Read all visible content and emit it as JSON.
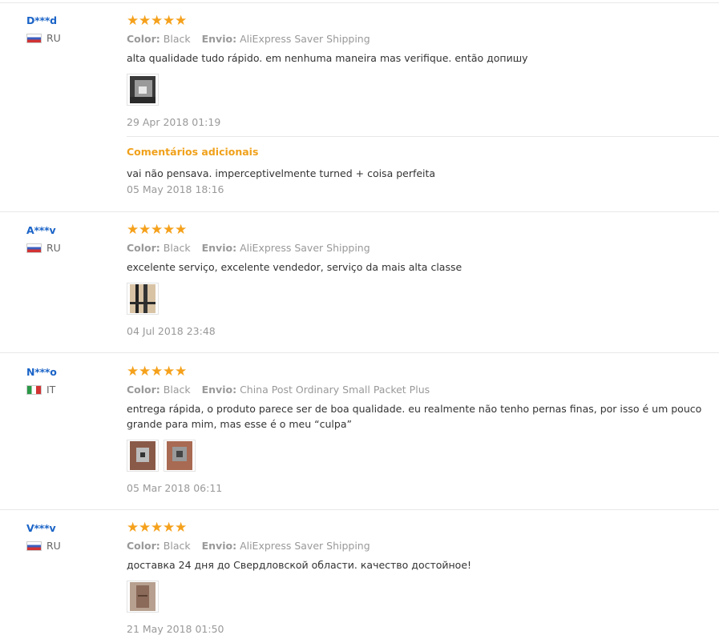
{
  "labels": {
    "color": "Color:",
    "shipping": "Envio:",
    "additional": "Comentários adicionais"
  },
  "reviews": [
    {
      "user": "D***d",
      "country": "RU",
      "flag": "ru",
      "rating": 5,
      "color": "Black",
      "shipping": "AliExpress Saver Shipping",
      "text": "alta qualidade tudo rápido. em nenhuma maneira mas verifique. então допишу",
      "photos": 1,
      "date": "29 Apr 2018 01:19",
      "additional": {
        "text": "vai não pensava. imperceptivelmente turned + coisa perfeita",
        "date": "05 May 2018 18:16"
      }
    },
    {
      "user": "A***v",
      "country": "RU",
      "flag": "ru",
      "rating": 5,
      "color": "Black",
      "shipping": "AliExpress Saver Shipping",
      "text": "excelente serviço, excelente vendedor, serviço da mais alta classe",
      "photos": 1,
      "date": "04 Jul 2018 23:48"
    },
    {
      "user": "N***o",
      "country": "IT",
      "flag": "it",
      "rating": 5,
      "color": "Black",
      "shipping": "China Post Ordinary Small Packet Plus",
      "text": "entrega rápida, o produto parece ser de boa qualidade. eu realmente não tenho pernas finas, por isso é um pouco grande para mim, mas esse é o meu “culpa”",
      "photos": 2,
      "date": "05 Mar 2018 06:11"
    },
    {
      "user": "V***v",
      "country": "RU",
      "flag": "ru",
      "rating": 5,
      "color": "Black",
      "shipping": "AliExpress Saver Shipping",
      "text": "доставка 24 дня до Свердловской области. качество достойное!",
      "photos": 1,
      "date": "21 May 2018 01:50"
    }
  ]
}
